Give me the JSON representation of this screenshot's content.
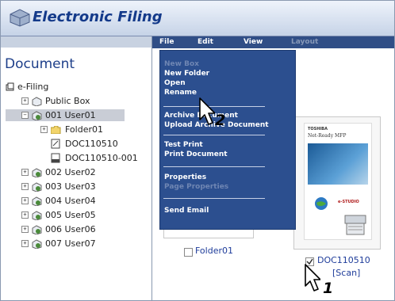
{
  "app": {
    "title": "Electronic Filing"
  },
  "left_panel": {
    "title": "Document",
    "tree": [
      {
        "label": "e-Filing",
        "icon": "efiling-root-icon"
      },
      {
        "label": "Public Box",
        "icon": "public-box-icon"
      },
      {
        "label": "001 User01",
        "icon": "user-box-icon"
      },
      {
        "label": "Folder01",
        "icon": "folder-icon"
      },
      {
        "label": "DOC110510",
        "icon": "document-icon"
      },
      {
        "label": "DOC110510-001",
        "icon": "document-icon"
      },
      {
        "label": "002 User02",
        "icon": "user-box-icon"
      },
      {
        "label": "003 User03",
        "icon": "user-box-icon"
      },
      {
        "label": "004 User04",
        "icon": "user-box-icon"
      },
      {
        "label": "005 User05",
        "icon": "user-box-icon"
      },
      {
        "label": "006 User06",
        "icon": "user-box-icon"
      },
      {
        "label": "007 User07",
        "icon": "user-box-icon"
      }
    ]
  },
  "menubar": {
    "items": [
      {
        "label": "File"
      },
      {
        "label": "Edit"
      },
      {
        "label": "View"
      },
      {
        "label": "Layout"
      }
    ]
  },
  "file_menu": {
    "items": [
      {
        "label": "New Box"
      },
      {
        "label": "New Folder"
      },
      {
        "label": "Open"
      },
      {
        "label": "Rename"
      },
      {
        "label": "Archive Document"
      },
      {
        "label": "Upload Archive Document"
      },
      {
        "label": "Test Print"
      },
      {
        "label": "Print Document"
      },
      {
        "label": "Properties"
      },
      {
        "label": "Page Properties"
      },
      {
        "label": "Send Email"
      }
    ]
  },
  "content": {
    "folder": {
      "label": "Folder01"
    },
    "document": {
      "label": "DOC110510",
      "sublabel": "[Scan]"
    },
    "thumbnail": {
      "brand": "TOSHIBA",
      "product": "Net-Ready MFP",
      "badge": "e-STUDIO"
    }
  },
  "callouts": {
    "step1": "1",
    "step2": "2"
  },
  "colors": {
    "menubar": "#304e86",
    "dropdown": "#2c4f8f",
    "title": "#143a8a",
    "link": "#1e3c9a"
  }
}
